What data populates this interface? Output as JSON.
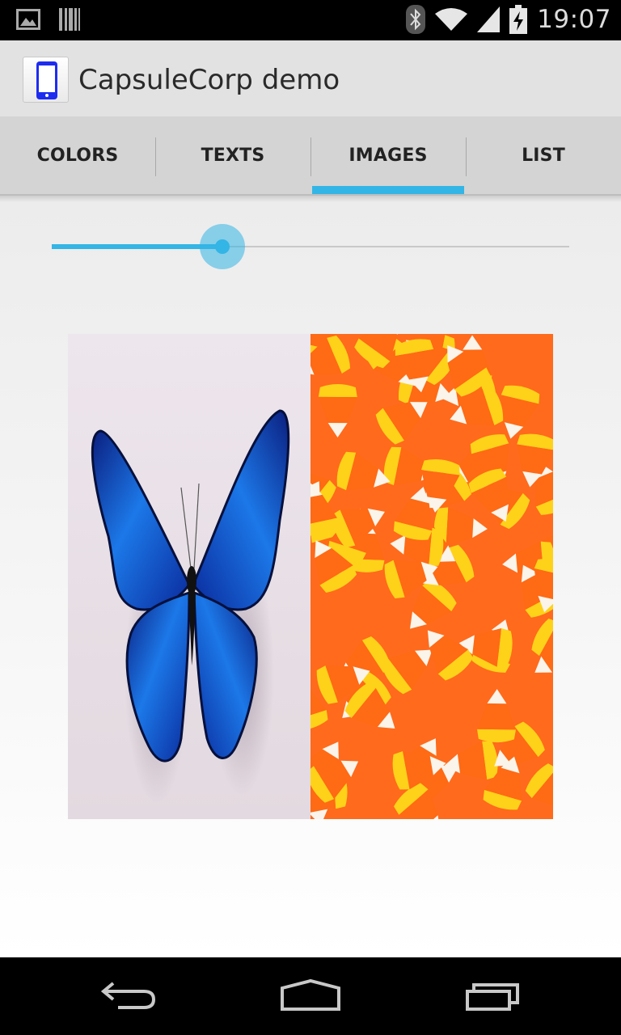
{
  "status_bar": {
    "time": "19:07",
    "left_icons": [
      "picture-notification-icon",
      "barcode-notification-icon"
    ],
    "right_icons": [
      "bluetooth-icon",
      "wifi-icon",
      "signal-icon",
      "battery-icon"
    ]
  },
  "action_bar": {
    "title": "CapsuleCorp demo",
    "icon": "phone-app-icon"
  },
  "tabs": [
    {
      "label": "COLORS",
      "selected": false
    },
    {
      "label": "TEXTS",
      "selected": false
    },
    {
      "label": "IMAGES",
      "selected": true
    },
    {
      "label": "LIST",
      "selected": false
    }
  ],
  "slider": {
    "value_fraction": 0.33
  },
  "images": [
    {
      "subject": "butterfly-image"
    },
    {
      "subject": "candy-corn-image"
    }
  ],
  "navigation": {
    "buttons": [
      "back-icon",
      "home-icon",
      "recent-apps-icon"
    ]
  },
  "colors": {
    "accent": "#33b5e5",
    "action_bar_bg": "#e2e2e2",
    "tab_bar_bg": "#d4d4d4"
  }
}
